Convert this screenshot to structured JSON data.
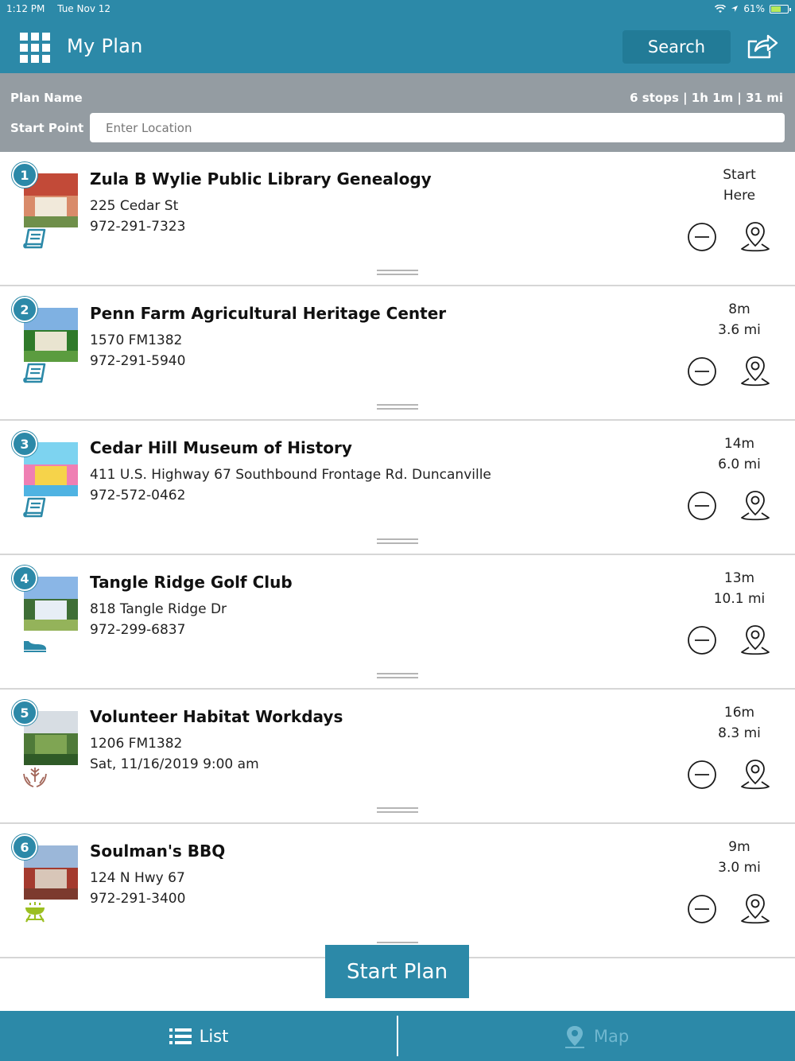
{
  "status_bar": {
    "time": "1:12 PM",
    "date": "Tue Nov 12",
    "battery": "61%",
    "battery_level": 0.61
  },
  "header": {
    "title": "My Plan",
    "search_label": "Search"
  },
  "plan": {
    "name_label": "Plan Name",
    "stats": "6 stops | 1h 1m | 31 mi",
    "start_label": "Start Point",
    "start_placeholder": "Enter Location",
    "start_value": ""
  },
  "stops": [
    {
      "number": "1",
      "name": "Zula B Wylie Public Library Genealogy",
      "line1": "225 Cedar St",
      "line2": "972-291-7323",
      "time": "Start",
      "distance": "Here",
      "category_icon": "book-icon",
      "color": "#2c89a8"
    },
    {
      "number": "2",
      "name": "Penn Farm Agricultural Heritage Center",
      "line1": "1570 FM1382",
      "line2": "972-291-5940",
      "time": "8m",
      "distance": "3.6 mi",
      "category_icon": "book-icon",
      "color": "#2c89a8"
    },
    {
      "number": "3",
      "name": "Cedar Hill Museum of History",
      "line1": "411 U.S. Highway 67 Southbound Frontage Rd. Duncanville",
      "line2": "972-572-0462",
      "time": "14m",
      "distance": "6.0 mi",
      "category_icon": "book-icon",
      "color": "#2c89a8"
    },
    {
      "number": "4",
      "name": "Tangle Ridge Golf Club",
      "line1": "818 Tangle Ridge Dr",
      "line2": "972-299-6837",
      "time": "13m",
      "distance": "10.1 mi",
      "category_icon": "shoe-icon",
      "color": "#2c89a8"
    },
    {
      "number": "5",
      "name": "Volunteer Habitat Workdays",
      "line1": "1206 FM1382",
      "line2": "Sat, 11/16/2019 9:00 am",
      "time": "16m",
      "distance": "8.3 mi",
      "category_icon": "hands-plant-icon",
      "color": "#a3675a"
    },
    {
      "number": "6",
      "name": "Soulman's BBQ",
      "line1": "124 N Hwy 67",
      "line2": "972-291-3400",
      "time": "9m",
      "distance": "3.0 mi",
      "category_icon": "grill-icon",
      "color": "#9bbf20"
    }
  ],
  "start_plan_label": "Start Plan",
  "tabs": {
    "list": "List",
    "map": "Map"
  },
  "colors": {
    "brand": "#2c89a8",
    "plan_bar": "#949ca2"
  }
}
